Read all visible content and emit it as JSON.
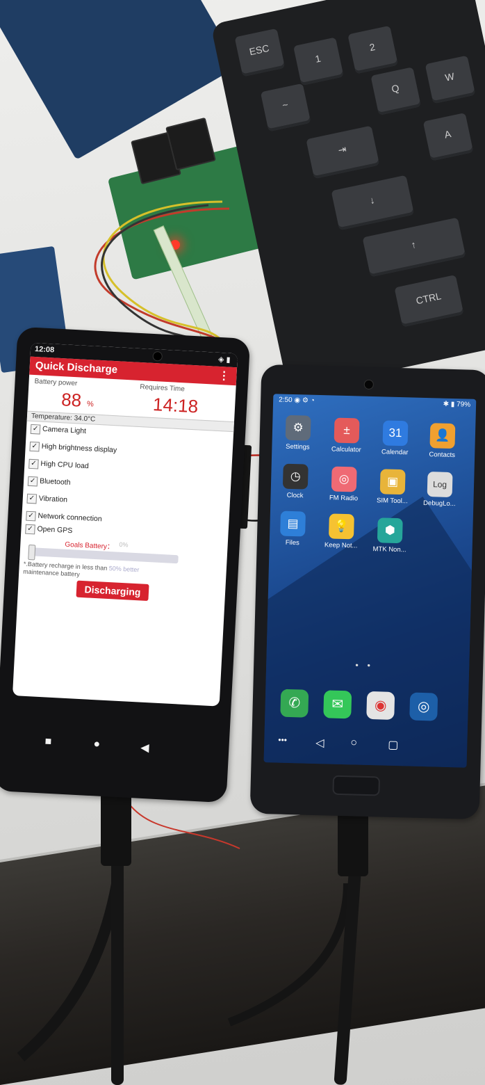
{
  "left_phone": {
    "status_bar": {
      "time": "12:08",
      "icons": "◈ ▮"
    },
    "app_title": "Quick Discharge",
    "menu_icon": "more-vert-icon",
    "battery_power_label": "Battery power",
    "battery_power_value": "88",
    "battery_power_unit": "%",
    "requires_time_label": "Requires Time",
    "requires_time_value": "14:18",
    "temperature_text": "Temperature:  34.0°C",
    "options": [
      {
        "label": "Camera Light",
        "checked": true
      },
      {
        "label": "High brightness display",
        "checked": true
      },
      {
        "label": "High CPU load",
        "checked": true
      },
      {
        "label": "Bluetooth",
        "checked": true
      },
      {
        "label": "Vibration",
        "checked": true
      },
      {
        "label": "Network connection",
        "checked": true
      },
      {
        "label": "Open GPS",
        "checked": true
      }
    ],
    "goals_label": "Goals Battery：",
    "goals_value": "0%",
    "goals_slider_fraction": 0.0,
    "note": "*.Battery recharge in less than",
    "note_hint": "50% better",
    "note_tail": "maintenance battery",
    "button": "Discharging",
    "nav": {
      "recent": "■",
      "home": "●",
      "back": "◀"
    }
  },
  "right_phone": {
    "status_bar": {
      "time": "2:50",
      "left_icons": "◉ ⚙ ◔",
      "right_icons": "✱ ▮",
      "battery": "79%"
    },
    "apps": [
      {
        "label": "Settings",
        "icon": "⚙",
        "color": "#5f6b7a"
      },
      {
        "label": "Calculator",
        "icon": "±",
        "color": "#e45a5a"
      },
      {
        "label": "Calendar",
        "icon": "31",
        "color": "#2f7be0"
      },
      {
        "label": "Contacts",
        "icon": "👤",
        "color": "#f0a030"
      },
      {
        "label": "Clock",
        "icon": "◷",
        "color": "#333333"
      },
      {
        "label": "FM Radio",
        "icon": "◎",
        "color": "#ef6a74"
      },
      {
        "label": "SIM Tool...",
        "icon": "▣",
        "color": "#e8b43a"
      },
      {
        "label": "DebugLo...",
        "icon": "Log",
        "color": "#dcdcdc"
      },
      {
        "label": "Files",
        "icon": "▤",
        "color": "#2e7fd8"
      },
      {
        "label": "Keep Not...",
        "icon": "💡",
        "color": "#f5c232"
      },
      {
        "label": "MTK Non...",
        "icon": "⬢",
        "color": "#26a69a"
      }
    ],
    "page_dots": "● ●",
    "dock": [
      {
        "name": "phone",
        "icon": "✆",
        "color": "#34a853"
      },
      {
        "name": "messages",
        "icon": "✉",
        "color": "#34c759"
      },
      {
        "name": "chrome",
        "icon": "◉",
        "color": "#e4e4e4"
      },
      {
        "name": "camera",
        "icon": "◎",
        "color": "#1d5fa8"
      }
    ],
    "nav": {
      "menu": "•••",
      "back": "◁",
      "home": "○",
      "recent": "▢"
    }
  },
  "keyboard_keys": [
    "ESC",
    "1",
    "2",
    "~",
    "Q",
    "W",
    "⇥",
    "A",
    "↓",
    "↑",
    "CTRL"
  ]
}
